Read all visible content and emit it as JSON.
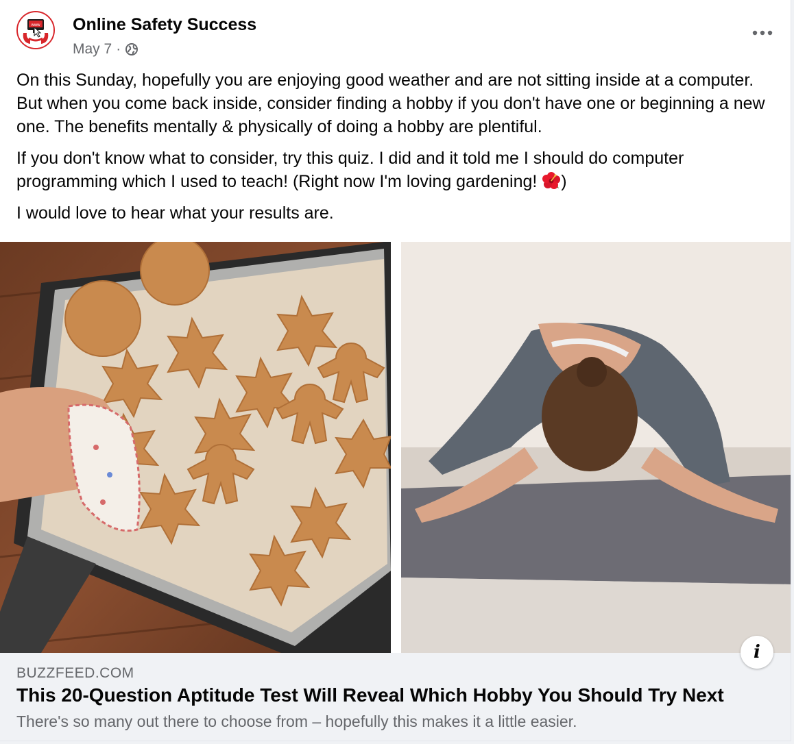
{
  "post": {
    "author": "Online Safety Success",
    "date": "May 7",
    "separator": "·",
    "visibility_icon": "globe-icon",
    "more_icon": "more-options-icon",
    "paragraphs": [
      "On this Sunday, hopefully you are enjoying good weather and are not sitting inside at a computer. But when you come back inside, consider finding a hobby if you don't have one or beginning a new one. The benefits mentally & physically of doing a hobby are plentiful.",
      "If you don't know what to consider, try this quiz. I did and it told me I should do computer programming which I used to teach! (Right now I'm loving gardening! ",
      ")",
      "I would love to hear what your results are."
    ],
    "emoji_icon": "hibiscus-flower-icon"
  },
  "link_preview": {
    "domain": "BUZZFEED.COM",
    "title": "This 20-Question Aptitude Test Will Reveal Which Hobby You Should Try Next",
    "description": "There's so many out there to choose from – hopefully this makes it a little easier.",
    "info_label": "i",
    "images": [
      "cookies-baking-tray-image",
      "yoga-childs-pose-image"
    ]
  },
  "colors": {
    "text_primary": "#050505",
    "text_secondary": "#65676b",
    "link_background": "#f0f2f5",
    "brand_red": "#d8262b"
  }
}
